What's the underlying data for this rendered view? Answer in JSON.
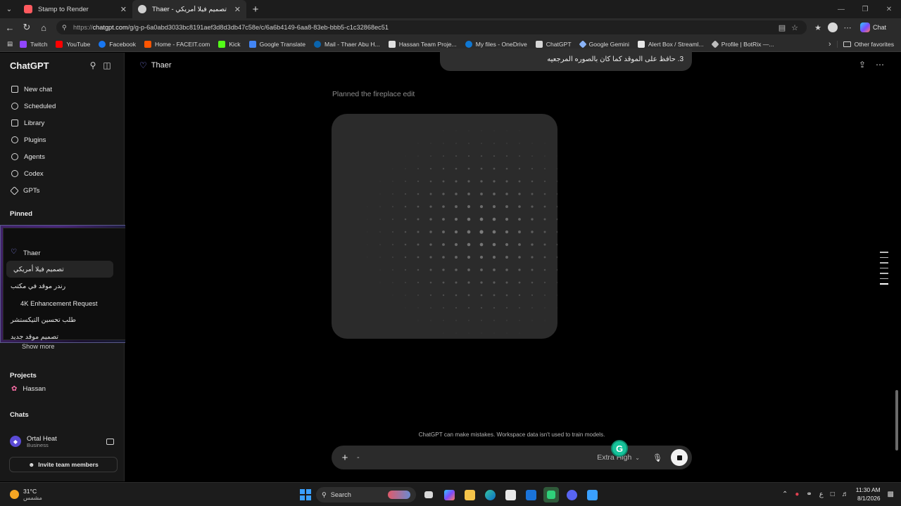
{
  "browser": {
    "tabs": [
      {
        "title": "Stamp to Render",
        "favicon_color": "#ff5a5f"
      },
      {
        "title": "Thaer - تصميم فيلا أمريكي",
        "favicon_color": "#d0d0d0"
      }
    ],
    "url_prefix": "https://",
    "url_host": "chatgpt.com",
    "url_path": "/g/g-p-6a0abd3033bc8191aef3d8d3db47c58e/c/6a6b4149-6aa8-83eb-bbb5-c1c32868ec51",
    "copilot_label": "Chat",
    "bookmarks": [
      {
        "label": "Twitch",
        "color": "#9146ff"
      },
      {
        "label": "YouTube",
        "color": "#ff0000"
      },
      {
        "label": "Facebook",
        "color": "#1877f2"
      },
      {
        "label": "Home - FACEIT.com",
        "color": "#ff5500"
      },
      {
        "label": "Kick",
        "color": "#53fc18"
      },
      {
        "label": "Google Translate",
        "color": "#4285f4"
      },
      {
        "label": "Mail - Thaer Abu H...",
        "color": "#0a64ad"
      },
      {
        "label": "Hassan Team Proje...",
        "color": "#e0e0e0"
      },
      {
        "label": "My files - OneDrive",
        "color": "#0f78d4"
      },
      {
        "label": "ChatGPT",
        "color": "#d6d6d6"
      },
      {
        "label": "Google Gemini",
        "color": "#8ab4f8"
      },
      {
        "label": "Alert Box / Streaml...",
        "color": "#e6e6e6"
      },
      {
        "label": "Profile | BotRix —...",
        "color": "#bdbdbd"
      }
    ],
    "other_favorites": "Other favorites"
  },
  "sidebar": {
    "brand": "ChatGPT",
    "nav": [
      {
        "label": "New chat",
        "icon": "edit-icon"
      },
      {
        "label": "Scheduled",
        "icon": "clock-icon"
      },
      {
        "label": "Library",
        "icon": "library-icon"
      },
      {
        "label": "Plugins",
        "icon": "plugin-icon"
      },
      {
        "label": "Agents",
        "icon": "agent-icon"
      },
      {
        "label": "Codex",
        "icon": "codex-icon"
      },
      {
        "label": "GPTs",
        "icon": "gpts-icon"
      }
    ],
    "pinned_label": "Pinned",
    "pinned_gpt": "Thaer",
    "pinned_chats": [
      "تصميم فيلا أمريكي",
      "رندر موقد في مكتب",
      "4K Enhancement Request",
      "طلب تحسين التيكستشر",
      "تصميم موقد جديد"
    ],
    "show_more": "Show more",
    "projects_label": "Projects",
    "project": "Hassan",
    "chats_label": "Chats",
    "account_name": "Ortal Heat",
    "account_plan": "Business",
    "invite": "Invite team members"
  },
  "main": {
    "gpt_name": "Thaer",
    "user_message_line": "3. حافظ على الموقد كما كان بالصوره المرجعيه",
    "thinking": "Planned the fireplace edit",
    "disclaimer": "ChatGPT can make mistakes. Workspace data isn't used to train models.",
    "composer_text": "-",
    "model": "Extra High"
  },
  "taskbar": {
    "temp": "31°C",
    "weather": "مشمس",
    "search": "Search",
    "time": "11:30 AM",
    "date": "8/1/2026",
    "lang": "ع"
  }
}
